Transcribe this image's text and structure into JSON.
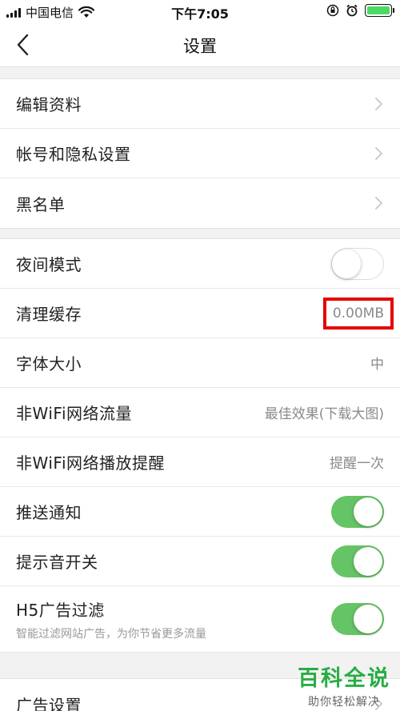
{
  "status_bar": {
    "carrier": "中国电信",
    "time": "下午7:05",
    "battery_level": 1.0,
    "battery_color": "#4cd964"
  },
  "navbar": {
    "title": "设置",
    "back_icon": "chevron-left-icon"
  },
  "group1": [
    {
      "label": "编辑资料"
    },
    {
      "label": "帐号和隐私设置"
    },
    {
      "label": "黑名单"
    }
  ],
  "group2": {
    "night_mode": {
      "label": "夜间模式",
      "enabled": false
    },
    "clear_cache": {
      "label": "清理缓存",
      "value": "0.00MB"
    },
    "font_size": {
      "label": "字体大小",
      "value": "中"
    },
    "non_wifi_traffic": {
      "label": "非WiFi网络流量",
      "value": "最佳效果(下载大图)"
    },
    "non_wifi_play": {
      "label": "非WiFi网络播放提醒",
      "value": "提醒一次"
    },
    "push": {
      "label": "推送通知",
      "enabled": true
    },
    "sound": {
      "label": "提示音开关",
      "enabled": true
    },
    "h5_filter": {
      "label": "H5广告过滤",
      "subtitle": "智能过滤网站广告，为你节省更多流量",
      "enabled": true
    }
  },
  "group3": [
    {
      "label": "广告设置"
    }
  ],
  "colors": {
    "toggle_on": "#65c466",
    "highlight": "#e60000",
    "watermark": "#27ad45"
  },
  "watermark": {
    "main": "百科全说",
    "sub": "助你轻松解决"
  }
}
